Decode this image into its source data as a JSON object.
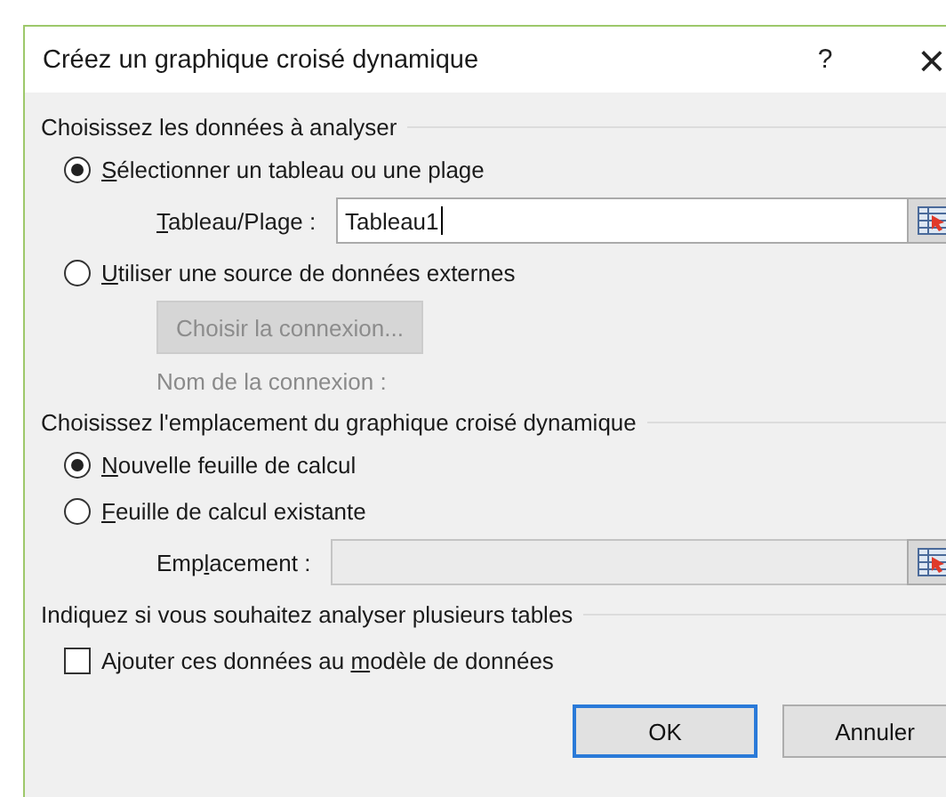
{
  "window": {
    "title": "Créez un graphique croisé dynamique",
    "help": "?",
    "close": "×"
  },
  "source": {
    "heading": "Choisissez les données à analyser",
    "options": [
      {
        "label": {
          "key": "S",
          "after": "électionner un tableau ou une plage"
        },
        "selected": true
      },
      {
        "label": {
          "key": "U",
          "after": "tiliser une source de données externes"
        },
        "selected": false
      }
    ],
    "range_field": {
      "label": {
        "key": "T",
        "after": "ableau/Plage :"
      },
      "value": "Tableau1"
    },
    "connection_button": {
      "label": "Choisir la connexion...",
      "disabled": true
    },
    "connection_name": {
      "label": "Nom de la connexion :",
      "disabled": true
    }
  },
  "location": {
    "heading": "Choisissez l'emplacement du graphique croisé dynamique",
    "options": [
      {
        "label": {
          "key": "N",
          "after": "ouvelle feuille de calcul"
        },
        "selected": true
      },
      {
        "label": {
          "key": "F",
          "after": "euille de calcul existante"
        },
        "selected": false
      }
    ],
    "location_field": {
      "label": {
        "before": "Emp",
        "key": "l",
        "after": "acement :"
      },
      "disabled": true
    }
  },
  "tables": {
    "heading": "Indiquez si vous souhaitez analyser plusieurs tables",
    "checkbox": {
      "label": {
        "before": "Ajouter ces données au ",
        "key": "m",
        "after": "odèle de données"
      },
      "checked": false
    }
  },
  "buttons": [
    {
      "label": "OK",
      "default": true
    },
    {
      "label": "Annuler",
      "default": false
    }
  ]
}
